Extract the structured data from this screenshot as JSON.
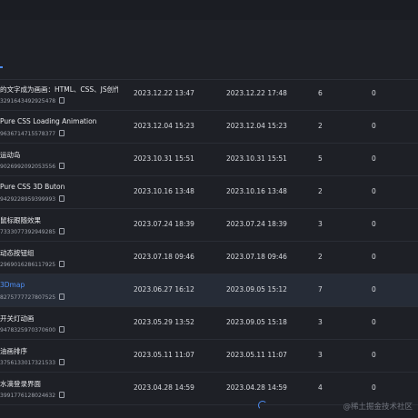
{
  "rows": [
    {
      "title": "的文字成为画画：HTML、CSS、JS创作...",
      "id": "3291643492925478",
      "created": "2023.12.22 13:47",
      "updated": "2023.12.22 17:48",
      "views": "6",
      "likes": "0"
    },
    {
      "title": "Pure CSS Loading Animation",
      "id": "9636714715578377",
      "created": "2023.12.04 15:23",
      "updated": "2023.12.04 15:23",
      "views": "2",
      "likes": "0"
    },
    {
      "title": "运动岛",
      "id": "9026992092053556",
      "created": "2023.10.31 15:51",
      "updated": "2023.10.31 15:51",
      "views": "5",
      "likes": "0"
    },
    {
      "title": "Pure CSS 3D Buton",
      "id": "9429228959399993",
      "created": "2023.10.16 13:48",
      "updated": "2023.10.16 13:48",
      "views": "2",
      "likes": "0"
    },
    {
      "title": "鼠标跟随效果",
      "id": "7333077392949285",
      "created": "2023.07.24 18:39",
      "updated": "2023.07.24 18:39",
      "views": "3",
      "likes": "0"
    },
    {
      "title": "动态按钮组",
      "id": "2969016286117925",
      "created": "2023.07.18 09:46",
      "updated": "2023.07.18 09:46",
      "views": "2",
      "likes": "0"
    },
    {
      "title": "3Dmap",
      "id": "8275777727807525",
      "created": "2023.06.27 16:12",
      "updated": "2023.09.05 15:12",
      "views": "7",
      "likes": "0",
      "highlight": true
    },
    {
      "title": "开关灯动画",
      "id": "9478325970370600",
      "created": "2023.05.29 13:52",
      "updated": "2023.09.05 15:18",
      "views": "3",
      "likes": "0"
    },
    {
      "title": "油画排序",
      "id": "3756133017321533",
      "created": "2023.05.11 11:07",
      "updated": "2023.05.11 11:07",
      "views": "3",
      "likes": "0"
    },
    {
      "title": "水滴登录界面",
      "id": "3991776128024632",
      "created": "2023.04.28 14:59",
      "updated": "2023.04.28 14:59",
      "views": "4",
      "likes": "0"
    }
  ],
  "watermark": "@稀土掘金技术社区"
}
